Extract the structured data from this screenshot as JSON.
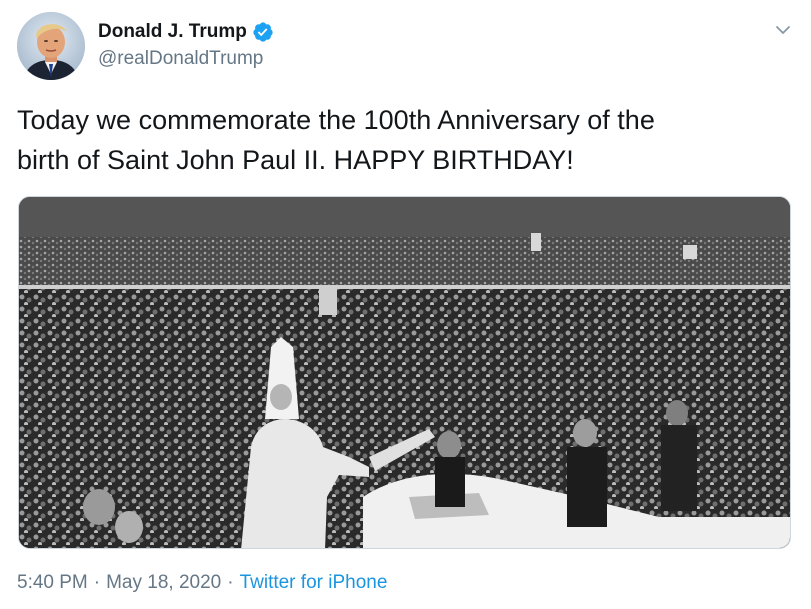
{
  "author": {
    "display_name": "Donald J. Trump",
    "handle": "@realDonaldTrump",
    "verified": true,
    "verified_badge_color": "#1da1f2"
  },
  "tweet": {
    "text_lines": [
      "Today we commemorate the 100th Anniversary of the",
      "birth of Saint John Paul II. HAPPY BIRTHDAY!"
    ]
  },
  "media": {
    "type": "photo",
    "style": "black-and-white"
  },
  "meta": {
    "time": "5:40 PM",
    "separator": "·",
    "date": "May 18, 2020",
    "source": "Twitter for iPhone"
  },
  "colors": {
    "text": "#14171a",
    "secondary": "#657786",
    "link": "#1b95e0"
  },
  "icons": {
    "more": "chevron-down-icon",
    "verified": "verified-badge-icon"
  }
}
